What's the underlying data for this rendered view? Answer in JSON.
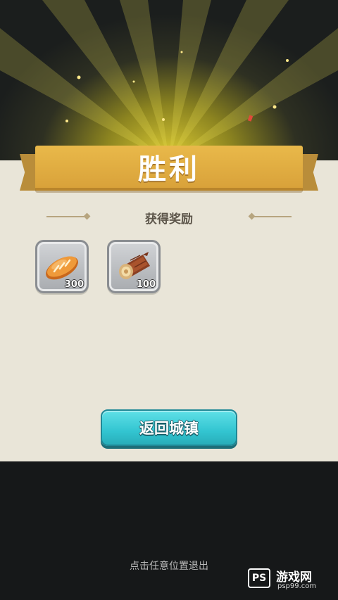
{
  "result": {
    "title": "胜利"
  },
  "rewards": {
    "header": "获得奖励",
    "items": [
      {
        "name": "bread-icon",
        "count": "300"
      },
      {
        "name": "wood-log-icon",
        "count": "100"
      }
    ]
  },
  "actions": {
    "return_label": "返回城镇"
  },
  "footer": {
    "exit_hint": "点击任意位置退出"
  },
  "watermark": {
    "logo": "PS",
    "name": "游戏网",
    "url": "psp99.com"
  },
  "colors": {
    "ribbon": "#e0ac42",
    "panel": "#e9e5d8",
    "button": "#3ccad6"
  }
}
